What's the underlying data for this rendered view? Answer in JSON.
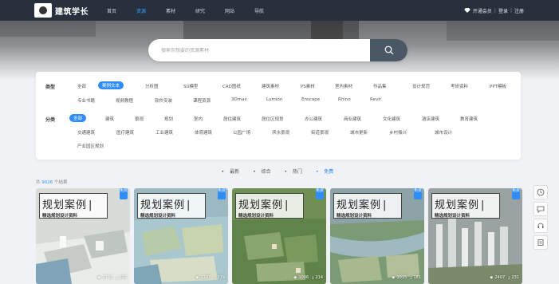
{
  "header": {
    "logo_text": "建筑学长",
    "nav": [
      "首页",
      "资源",
      "素材",
      "研究",
      "网站",
      "导航"
    ],
    "active_index": 1,
    "vip_label": "开通会员",
    "login": "登录",
    "register": "注册"
  },
  "search": {
    "placeholder": "搜索你想要的资源素材"
  },
  "filters": {
    "type_label": "类型",
    "type_options": [
      "全部",
      "案例文本",
      "分析图",
      "SU模型",
      "CAD图纸",
      "建筑素材",
      "PS素材",
      "室内素材",
      "作品集",
      "设计规范",
      "考研资料",
      "PPT模板",
      "专业书籍",
      "视频教程",
      "软件安装",
      "课程资源",
      "3Dmax",
      "Lumion",
      "Enscape",
      "Rhino",
      "Revit"
    ],
    "type_selected": 1,
    "category_label": "分类",
    "category_options": [
      "全部",
      "建筑",
      "景观",
      "规划",
      "室内",
      "居住建筑",
      "居住区规划",
      "办公建筑",
      "商业建筑",
      "文化建筑",
      "酒店建筑",
      "教育建筑",
      "交通建筑",
      "医疗建筑",
      "工业建筑",
      "体育建筑",
      "公园广场",
      "滨水景观",
      "街道景观",
      "城市更新",
      "乡村振兴",
      "城市设计",
      "产业园区规划"
    ],
    "category_selected": 0
  },
  "sort": {
    "options": [
      "最新",
      "综合",
      "热门",
      "免费"
    ],
    "selected": 3
  },
  "result_count": {
    "prefix": "共",
    "number": "9026",
    "suffix": "个结果"
  },
  "cards": [
    {
      "title": "规划案例",
      "subtitle": "精选规划设计资料",
      "badge": "免费",
      "views": "2172",
      "downloads": "202"
    },
    {
      "title": "规划案例",
      "subtitle": "精选规划设计资料",
      "badge": "免费",
      "views": "1107",
      "downloads": "219"
    },
    {
      "title": "规划案例",
      "subtitle": "精选规划设计资料",
      "badge": "免费",
      "views": "1006",
      "downloads": "214"
    },
    {
      "title": "规划案例",
      "subtitle": "精选规划设计资料",
      "badge": "免费",
      "views": "1015",
      "downloads": "181"
    },
    {
      "title": "规划案例",
      "subtitle": "精选规划设计资料",
      "badge": "免费",
      "views": "2407",
      "downloads": "231"
    }
  ],
  "colors": {
    "accent": "#2f8df5",
    "header_bg": "#1e2834",
    "search_button": "#4a5866"
  }
}
